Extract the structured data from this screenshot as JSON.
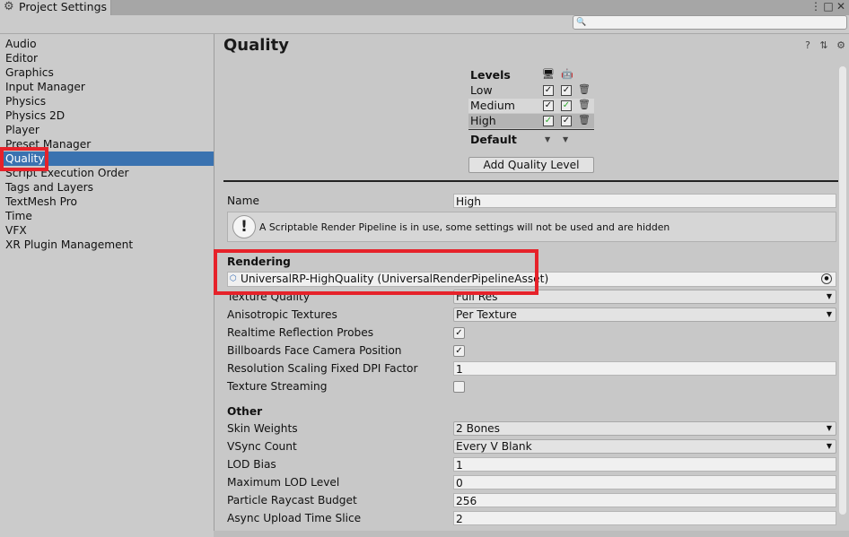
{
  "window": {
    "title": "Project Settings"
  },
  "search": {
    "placeholder": ""
  },
  "sidebar": {
    "items": [
      {
        "label": "Audio"
      },
      {
        "label": "Editor"
      },
      {
        "label": "Graphics"
      },
      {
        "label": "Input Manager"
      },
      {
        "label": "Physics"
      },
      {
        "label": "Physics 2D"
      },
      {
        "label": "Player"
      },
      {
        "label": "Preset Manager"
      },
      {
        "label": "Quality"
      },
      {
        "label": "Script Execution Order"
      },
      {
        "label": "Tags and Layers"
      },
      {
        "label": "TextMesh Pro"
      },
      {
        "label": "Time"
      },
      {
        "label": "VFX"
      },
      {
        "label": "XR Plugin Management"
      }
    ],
    "selected": "Quality"
  },
  "page": {
    "title": "Quality"
  },
  "levels": {
    "header": "Levels",
    "rows": [
      {
        "name": "Low",
        "standalone": true,
        "android": true
      },
      {
        "name": "Medium",
        "standalone": true,
        "android": true
      },
      {
        "name": "High",
        "standalone": true,
        "android": true
      }
    ],
    "default_label": "Default",
    "add_button": "Add Quality Level"
  },
  "settings": {
    "name_label": "Name",
    "name_value": "High",
    "warning": "A Scriptable Render Pipeline is in use, some settings will not be used and are hidden",
    "rendering_header": "Rendering",
    "render_pipeline": "UniversalRP-HighQuality (UniversalRenderPipelineAsset)",
    "texture_quality_label": "Texture Quality",
    "texture_quality_value": "Full Res",
    "aniso_label": "Anisotropic Textures",
    "aniso_value": "Per Texture",
    "realtime_reflection_label": "Realtime Reflection Probes",
    "realtime_reflection": true,
    "billboards_label": "Billboards Face Camera Position",
    "billboards": true,
    "res_scaling_label": "Resolution Scaling Fixed DPI Factor",
    "res_scaling_value": "1",
    "tex_streaming_label": "Texture Streaming",
    "tex_streaming": false,
    "other_header": "Other",
    "skin_weights_label": "Skin Weights",
    "skin_weights_value": "2 Bones",
    "vsync_label": "VSync Count",
    "vsync_value": "Every V Blank",
    "lod_bias_label": "LOD Bias",
    "lod_bias_value": "1",
    "max_lod_label": "Maximum LOD Level",
    "max_lod_value": "0",
    "particle_label": "Particle Raycast Budget",
    "particle_value": "256",
    "async_slice_label": "Async Upload Time Slice",
    "async_slice_value": "2"
  },
  "colors": {
    "selection": "#3a72b0",
    "highlight": "#e6222a",
    "green_check": "#2fa82f"
  }
}
